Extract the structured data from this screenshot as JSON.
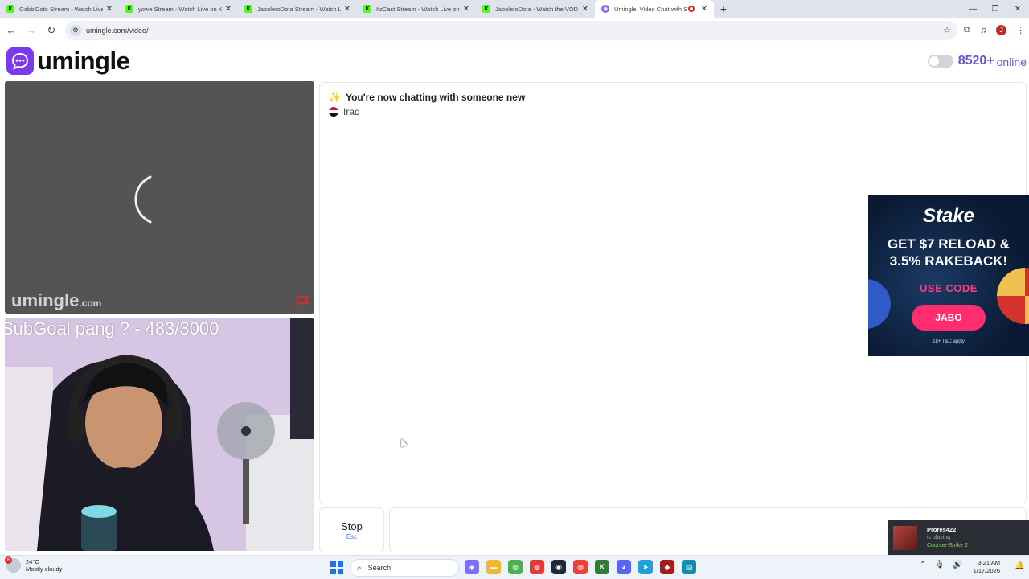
{
  "browser": {
    "tabs": [
      {
        "title": "GabbiDoto Stream - Watch Live",
        "favicon": "kick-icon"
      },
      {
        "title": "yowe Stream - Watch Live on K",
        "favicon": "kick-icon"
      },
      {
        "title": "JaboleroDota Stream - Watch L",
        "favicon": "kick-icon"
      },
      {
        "title": "ItzCast Stream - Watch Live on",
        "favicon": "kick-icon"
      },
      {
        "title": "JaboleroDota - Watch the VOD",
        "favicon": "kick-icon"
      },
      {
        "title": "Umingle: Video Chat with S",
        "favicon": "umingle-icon",
        "active": true,
        "recording": true
      }
    ],
    "new_tab": "+",
    "url": "umingle.com/video/",
    "profile_initial": "J"
  },
  "site": {
    "logo_text": "umingle",
    "online_count": "8520+",
    "online_label": "online",
    "brand_color": "#7c3aed"
  },
  "stranger_video": {
    "watermark": "umingle",
    "watermark_suffix": ".com",
    "state": "loading"
  },
  "my_video": {
    "overlay_text": "SubGoal pang ? - 483/3000"
  },
  "chat": {
    "status_emoji": "✨",
    "status_message": "You're now chatting with someone new",
    "country": "Iraq"
  },
  "controls": {
    "stop_label": "Stop",
    "stop_shortcut": "Esc",
    "input_value": ""
  },
  "ad": {
    "brand": "Stake",
    "headline_1": "GET $7 RELOAD &",
    "headline_2": "3.5% RAKEBACK!",
    "use_code_label": "USE CODE",
    "code": "JABO",
    "legal": "18+   T&C apply"
  },
  "steam_notification": {
    "name": "Prores422",
    "status": "is playing",
    "game": "Counter-Strike 2"
  },
  "taskbar": {
    "weather_badge": "6",
    "temperature": "24°C",
    "weather_desc": "Mostly cloudy",
    "search_placeholder": "Search",
    "time": "3:21 AM",
    "date": "1/17/2026"
  }
}
